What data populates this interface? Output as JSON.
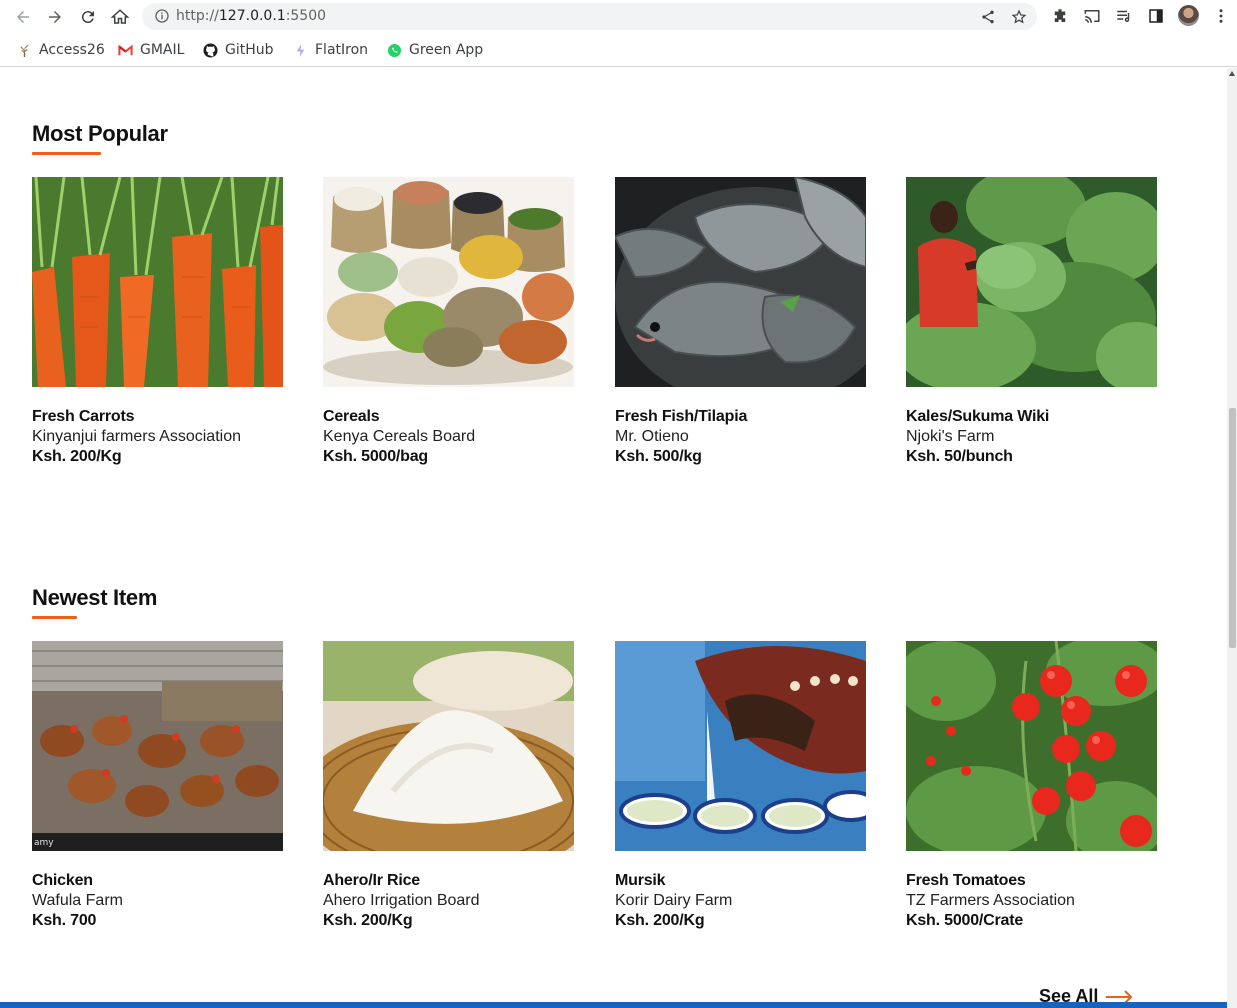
{
  "browser": {
    "url_scheme": "http://",
    "url_host": "127.0.0.1",
    "url_port": ":5500",
    "bookmarks": [
      {
        "label": "Access26",
        "icon": "tree-icon"
      },
      {
        "label": "GMAIL",
        "icon": "gmail-icon"
      },
      {
        "label": "GitHub",
        "icon": "github-icon"
      },
      {
        "label": "FlatIron",
        "icon": "flatiron-icon"
      },
      {
        "label": "Green App",
        "icon": "whatsapp-icon"
      }
    ]
  },
  "sections": {
    "popular": {
      "title": "Most Popular",
      "items": [
        {
          "name": "Fresh Carrots",
          "seller": "Kinyanjui farmers Association",
          "price": "Ksh. 200/Kg",
          "image": "carrots-image"
        },
        {
          "name": "Cereals",
          "seller": "Kenya Cereals Board",
          "price": "Ksh. 5000/bag",
          "image": "cereals-image"
        },
        {
          "name": "Fresh Fish/Tilapia",
          "seller": "Mr. Otieno",
          "price": "Ksh. 500/kg",
          "image": "tilapia-image"
        },
        {
          "name": "Kales/Sukuma Wiki",
          "seller": "Njoki's Farm",
          "price": "Ksh. 50/bunch",
          "image": "kales-image"
        }
      ]
    },
    "newest": {
      "title": "Newest Item",
      "items": [
        {
          "name": "Chicken",
          "seller": "Wafula Farm",
          "price": "Ksh. 700",
          "image": "chicken-image"
        },
        {
          "name": "Ahero/Ir Rice",
          "seller": "Ahero Irrigation Board",
          "price": "Ksh. 200/Kg",
          "image": "rice-image"
        },
        {
          "name": "Mursik",
          "seller": "Korir Dairy Farm",
          "price": "Ksh. 200/Kg",
          "image": "mursik-image"
        },
        {
          "name": "Fresh Tomatoes",
          "seller": "TZ Farmers Association",
          "price": "Ksh. 5000/Crate",
          "image": "tomatoes-image"
        }
      ]
    }
  },
  "see_all_label": "See All",
  "colors": {
    "accent": "#ef5f17",
    "text": "#111111"
  }
}
